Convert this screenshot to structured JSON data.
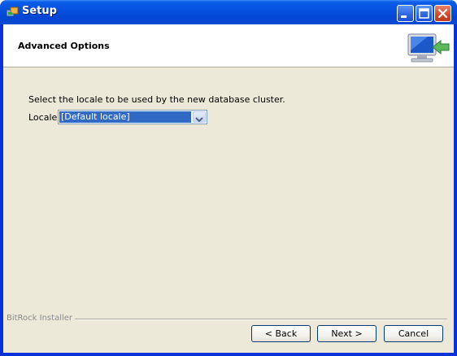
{
  "window": {
    "title": "Setup"
  },
  "header": {
    "title": "Advanced Options"
  },
  "content": {
    "prompt": "Select the locale to be used by the new database cluster.",
    "locale_label": "Locale",
    "locale_selected": "[Default locale]"
  },
  "footer": {
    "brand": "BitRock Installer",
    "back_label": "< Back",
    "next_label": "Next >",
    "cancel_label": "Cancel"
  },
  "icons": [
    "setup-app-icon",
    "minimize-icon",
    "maximize-icon",
    "close-icon",
    "computer-arrow-icon",
    "chevron-down-icon"
  ],
  "colors": {
    "titlebar": "#0551e0",
    "dialog_bg": "#ece9d8",
    "selection": "#316ac5"
  }
}
